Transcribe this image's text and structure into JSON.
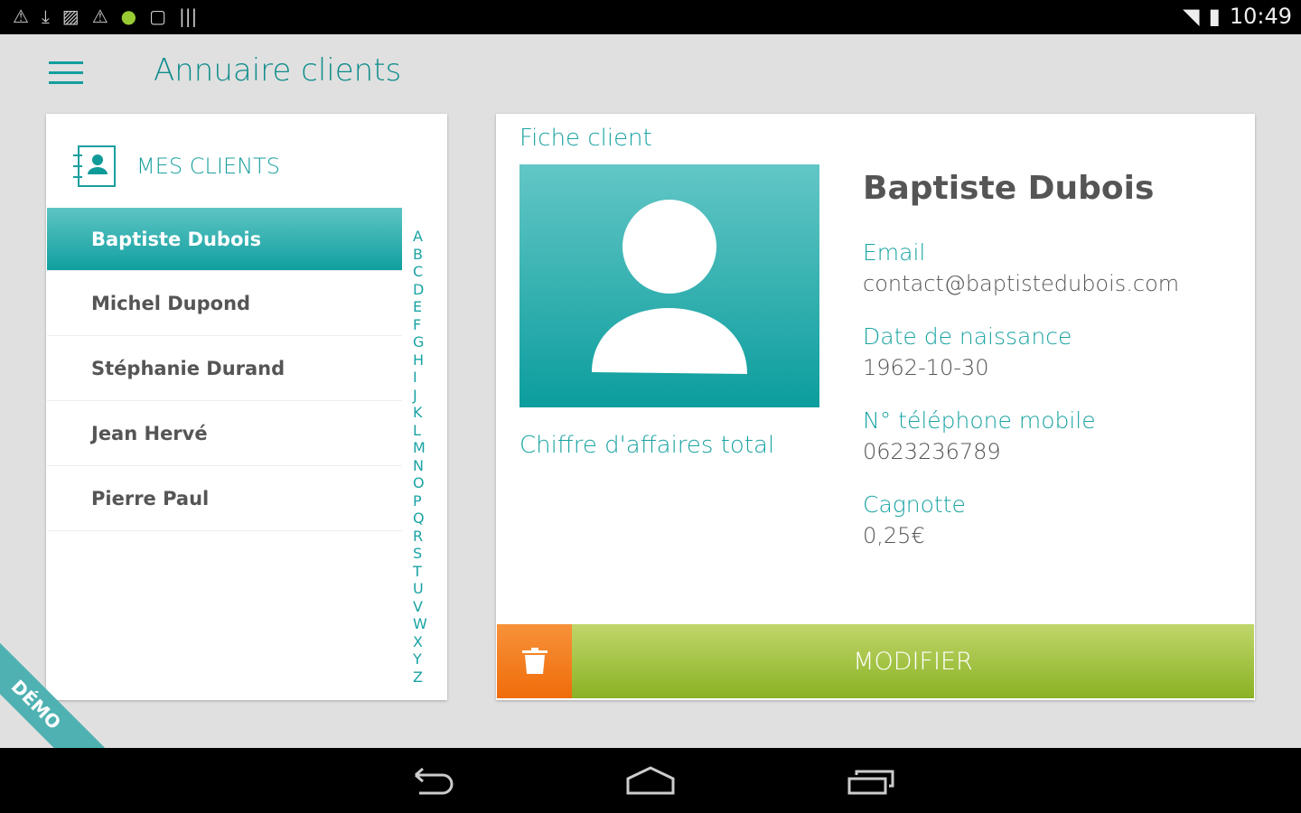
{
  "status": {
    "time": "10:49",
    "icons": [
      "warning-icon",
      "download-icon",
      "image-icon",
      "warning-icon",
      "android-icon",
      "watch-icon",
      "barcode-icon"
    ]
  },
  "app": {
    "title": "Annuaire clients"
  },
  "sidebar": {
    "header": "MES CLIENTS",
    "clients": [
      "Baptiste Dubois",
      "Michel Dupond",
      "Stéphanie Durand",
      "Jean Hervé",
      "Pierre Paul"
    ],
    "selected": 0,
    "alphabet": [
      "A",
      "B",
      "C",
      "D",
      "E",
      "F",
      "G",
      "H",
      "I",
      "J",
      "K",
      "L",
      "M",
      "N",
      "O",
      "P",
      "Q",
      "R",
      "S",
      "T",
      "U",
      "V",
      "W",
      "X",
      "Y",
      "Z"
    ]
  },
  "detail": {
    "heading": "Fiche client",
    "name": "Baptiste Dubois",
    "revenue_label": "Chiffre d'affaires total",
    "fields": [
      {
        "label": "Email",
        "value": "contact@baptistedubois.com"
      },
      {
        "label": "Date de naissance",
        "value": "1962-10-30"
      },
      {
        "label": "N° téléphone mobile",
        "value": "0623236789"
      },
      {
        "label": "Cagnotte",
        "value": "0,25€"
      }
    ],
    "modify_label": "MODIFIER"
  },
  "demo_label": "DÉMO",
  "colors": {
    "accent": "#139e9e",
    "modify": "#9cc23a",
    "delete": "#f27a1a"
  }
}
